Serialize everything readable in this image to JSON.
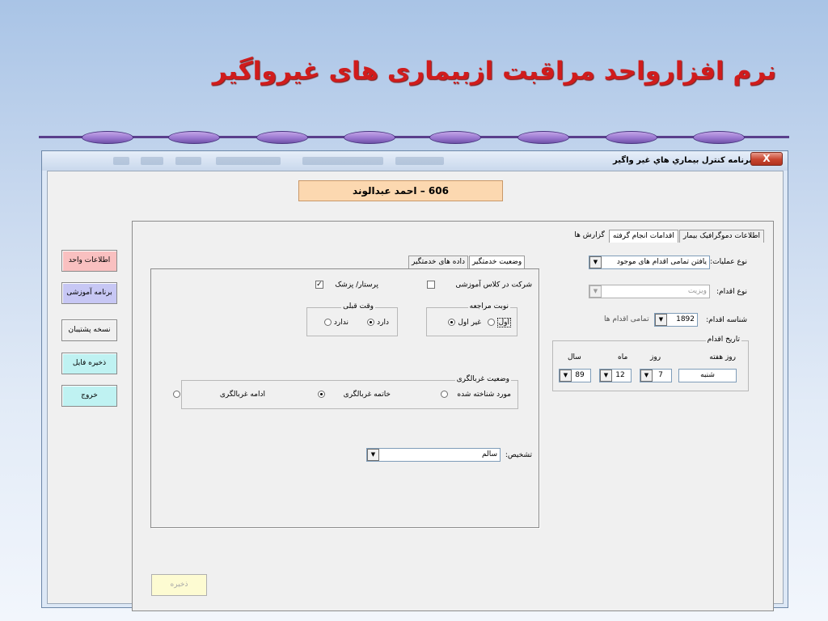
{
  "slide": {
    "title": "نرم افزارواحد مراقبت ازبیماری های غیرواگیر"
  },
  "window": {
    "title": "برنامه کنترل بيماري هاي غير واگير",
    "close_label": "X"
  },
  "patient": {
    "id_name": "606 – احمد عبدالوند"
  },
  "left_buttons": {
    "unit_info": "اطلاعات واحد",
    "training": "برنامه آموزشی",
    "backup": "نسخه پشتیبان",
    "save_file": "ذخیره فایل",
    "exit": "خروج"
  },
  "right_tabs": {
    "demographics": "اطلاعات دموگرافیک بیمار",
    "actions": "اقدامات انجام گرفته",
    "reports": "گزارش ها"
  },
  "right_form": {
    "operation_type_label": "نوع عملیات:",
    "operation_type_value": "یافتن تمامی اقدام های موجود",
    "action_type_label": "نوع اقدام:",
    "action_type_value": "ویزیت",
    "action_id_label": "شناسه اقدام:",
    "action_id_value": "1892",
    "all_actions": "تمامی اقدام ها",
    "action_date_title": "تاریخ اقدام",
    "weekday_label": "روز هفته",
    "day_label": "روز",
    "month_label": "ماه",
    "year_label": "سال",
    "weekday_value": "شنبه",
    "day_value": "7",
    "month_value": "12",
    "year_value": "89"
  },
  "inner_tabs": {
    "provider_status": "وضعیت خدمتگیر",
    "provider_data": "داده های خدمتگیر"
  },
  "inner_form": {
    "class_participation": "شرکت در کلاس آموزشی",
    "nurse_doctor": "پرستار/ پزشک",
    "checked_mark": "✓",
    "visit_turn_title": "نوبت مراجعه",
    "first": "اول",
    "not_first": "غیر اول",
    "prior_appointment_title": "وقت قبلی",
    "has": "دارد",
    "has_not": "ندارد",
    "screening_title": "وضعیت غربالگری",
    "identified_case": "مورد شناخته شده",
    "screening_end": "خاتمه غربالگری",
    "screening_continue": "ادامه غربالگری",
    "diagnosis_label": "تشخیص:",
    "diagnosis_value": "سالم"
  },
  "actions": {
    "save": "ذخیره",
    "dropdown_arrow": "▼"
  },
  "colors": {
    "title_red": "#d01c1c",
    "name_box": "#fcd8b0",
    "btn_unit_info": "#f9c0c0",
    "btn_training": "#c7c7f4",
    "btn_backup": "#f0f0f0",
    "btn_save_file": "#bff2f2",
    "btn_exit": "#bff2f2",
    "save_btn": "#fdfbd2"
  }
}
